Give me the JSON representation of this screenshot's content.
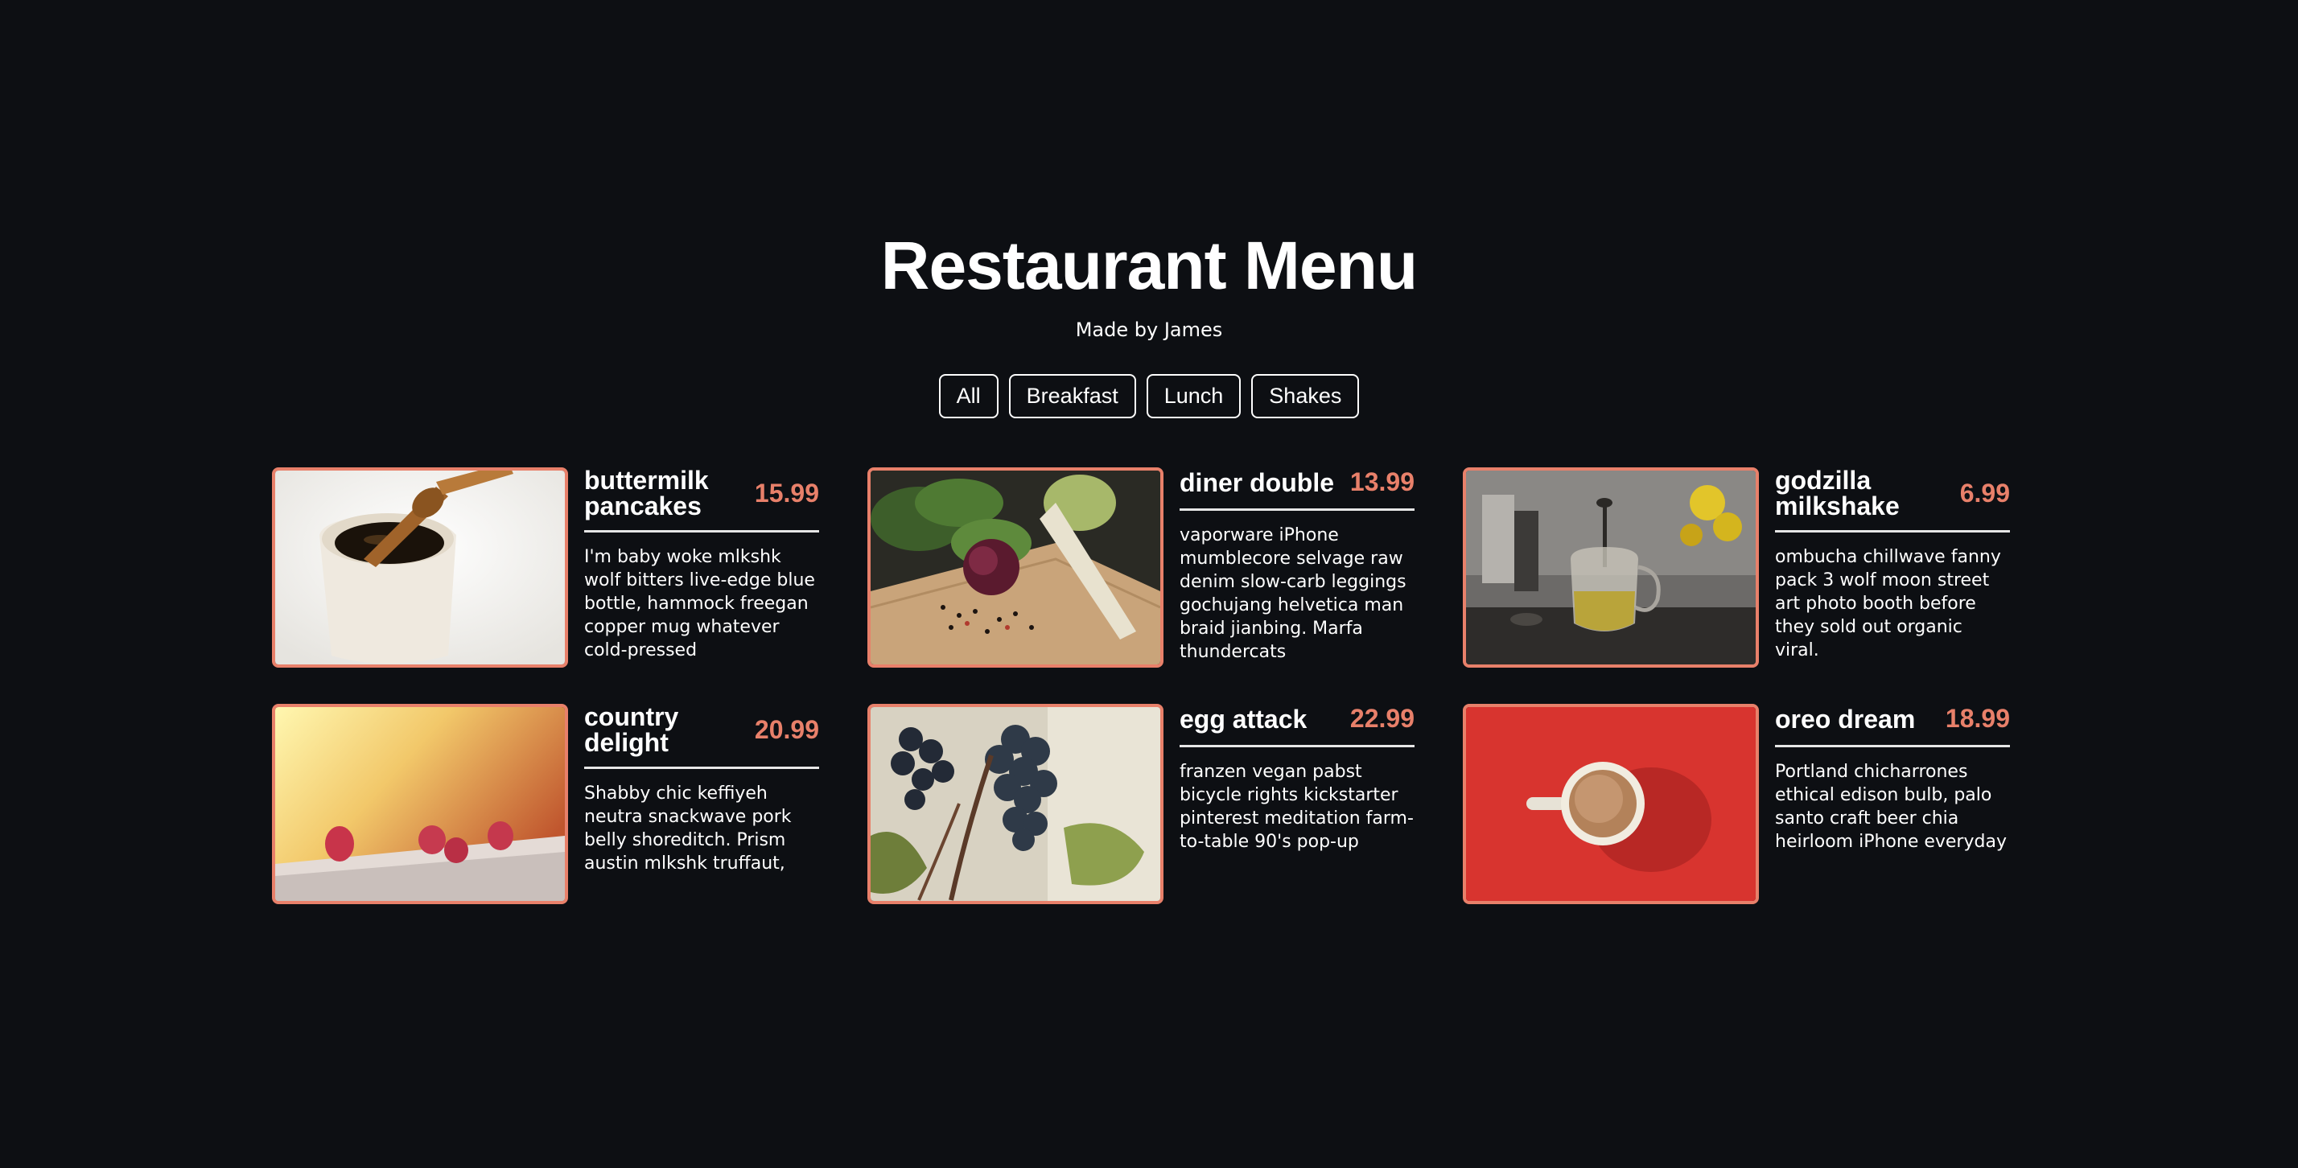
{
  "header": {
    "title": "Restaurant Menu",
    "subtitle": "Made by James"
  },
  "filters": [
    "All",
    "Breakfast",
    "Lunch",
    "Shakes"
  ],
  "accent_color": "#e8806a",
  "background_color": "#0d0f13",
  "items": [
    {
      "name": "buttermilk pancakes",
      "price": "15.99",
      "description": "I'm baby woke mlkshk wolf bitters live-edge blue bottle, hammock freegan copper mug whatever cold-pressed",
      "image": "honey-dipper-cup-photo"
    },
    {
      "name": "diner double",
      "price": "13.99",
      "description": "vaporware iPhone mumblecore selvage raw denim slow-carb leggings gochujang helvetica man braid jianbing. Marfa thundercats",
      "image": "vegetables-cutting-board-photo"
    },
    {
      "name": "godzilla milkshake",
      "price": "6.99",
      "description": "ombucha chillwave fanny pack 3 wolf moon street art photo booth before they sold out organic viral.",
      "image": "french-press-tea-photo"
    },
    {
      "name": "country delight",
      "price": "20.99",
      "description": "Shabby chic keffiyeh neutra snackwave pork belly shoreditch. Prism austin mlkshk truffaut,",
      "image": "raspberries-ledge-photo"
    },
    {
      "name": "egg attack",
      "price": "22.99",
      "description": "franzen vegan pabst bicycle rights kickstarter pinterest meditation farm-to-table 90's pop-up",
      "image": "grapes-vine-photo"
    },
    {
      "name": "oreo dream",
      "price": "18.99",
      "description": "Portland chicharrones ethical edison bulb, palo santo craft beer chia heirloom iPhone everyday",
      "image": "coffee-cup-red-photo"
    }
  ]
}
